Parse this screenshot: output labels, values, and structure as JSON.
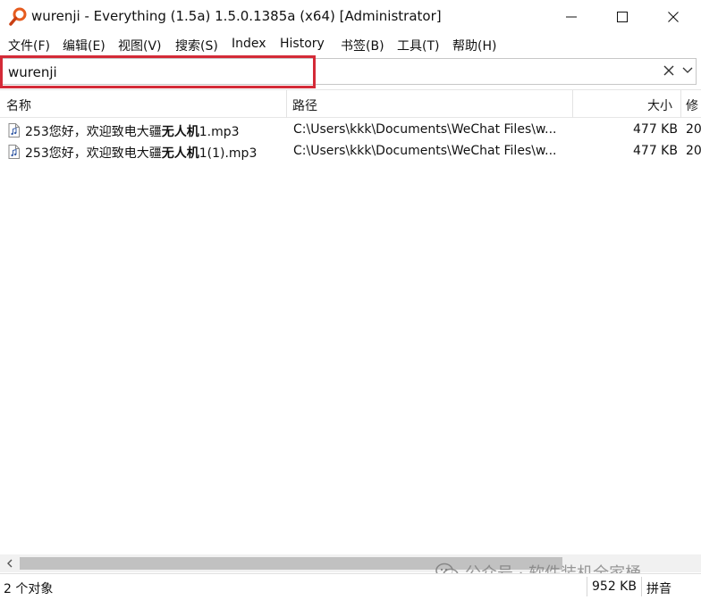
{
  "window": {
    "title": "wurenji - Everything (1.5a) 1.5.0.1385a (x64) [Administrator]",
    "icon": "magnifier-icon"
  },
  "menu": [
    {
      "label": "文件(F)"
    },
    {
      "label": "编辑(E)"
    },
    {
      "label": "视图(V)"
    },
    {
      "label": "搜索(S)"
    },
    {
      "label": "Index"
    },
    {
      "label": "History"
    },
    {
      "label": "书签(B)"
    },
    {
      "label": "工具(T)"
    },
    {
      "label": "帮助(H)"
    }
  ],
  "search": {
    "value": "wurenji",
    "highlight_color": "#d42a37"
  },
  "columns": {
    "name": "名称",
    "path": "路径",
    "size": "大小",
    "modified": "修"
  },
  "rows": [
    {
      "name_prefix": "253您好，欢迎致电大疆",
      "name_match": "无人机",
      "name_suffix": "1.mp3",
      "path": "C:\\Users\\kkk\\Documents\\WeChat Files\\w...",
      "size": "477 KB",
      "modified": "20"
    },
    {
      "name_prefix": "253您好，欢迎致电大疆",
      "name_match": "无人机",
      "name_suffix": "1(1).mp3",
      "path": "C:\\Users\\kkk\\Documents\\WeChat Files\\w...",
      "size": "477 KB",
      "modified": "20"
    }
  ],
  "status": {
    "count": "2 个对象",
    "total_size": "952 KB",
    "mode": "拼音"
  },
  "watermark": {
    "text": "公众号 · 软件装机全家桶",
    "icon": "wechat-icon"
  }
}
